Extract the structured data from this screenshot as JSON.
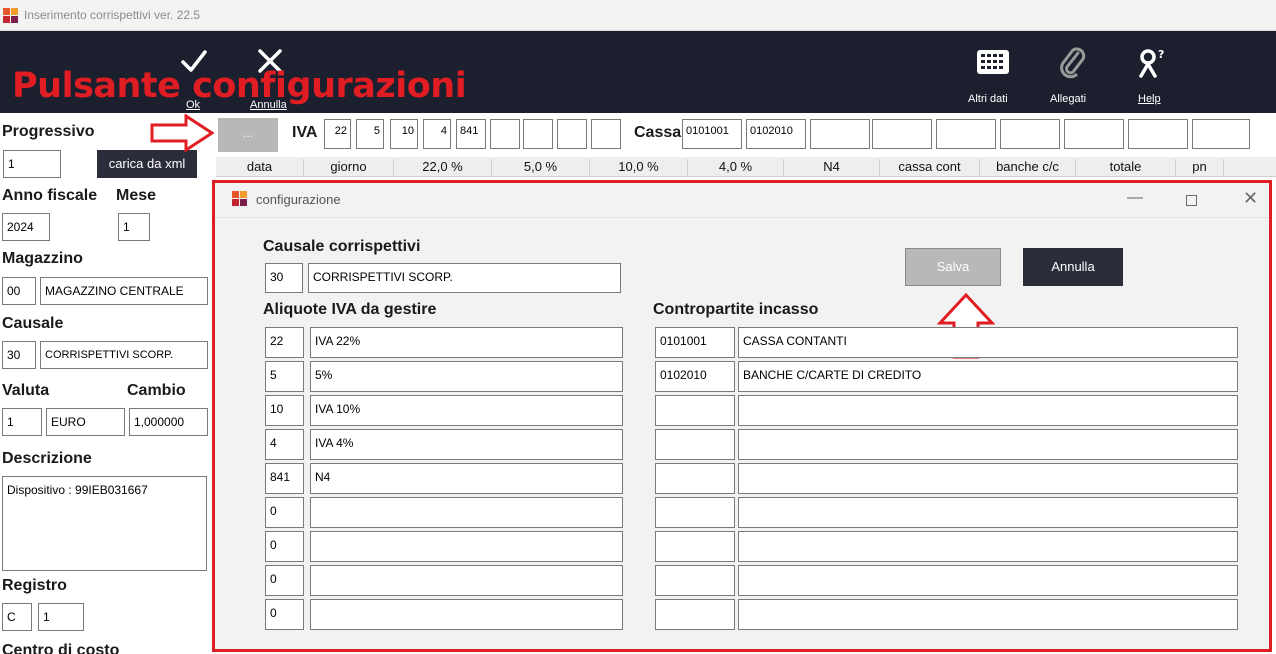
{
  "window": {
    "title": "Inserimento corrispettivi ver. 22.5"
  },
  "toolbar": {
    "ok_label": "Ok",
    "annulla_label": "Annulla",
    "altri_dati_label": "Altri dati",
    "allegati_label": "Allegati",
    "help_label": "Help"
  },
  "annotation": {
    "overlay_text": "Pulsante configurazioni"
  },
  "left_panel": {
    "progressivo_label": "Progressivo",
    "progressivo_value": "1",
    "carica_xml_label": "carica da xml",
    "anno_label": "Anno fiscale",
    "anno_value": "2024",
    "mese_label": "Mese",
    "mese_value": "1",
    "magazzino_label": "Magazzino",
    "magazzino_code": "00",
    "magazzino_name": "MAGAZZINO CENTRALE",
    "causale_label": "Causale",
    "causale_code": "30",
    "causale_name": "CORRISPETTIVI SCORP.",
    "valuta_label": "Valuta",
    "valuta_code": "1",
    "valuta_name": "EURO",
    "cambio_label": "Cambio",
    "cambio_value": "1,000000",
    "descrizione_label": "Descrizione",
    "descrizione_value": "Dispositivo : 99IEB031667",
    "registro_label": "Registro",
    "registro_code": "C",
    "registro_num": "1",
    "centro_costo_label": "Centro di costo"
  },
  "top_bar": {
    "config_button_label": "...",
    "iva_label": "IVA",
    "iva_values": [
      "22",
      "5",
      "10",
      "4",
      "841",
      "",
      "",
      "",
      ""
    ],
    "cassa_label": "Cassa",
    "cassa_values": [
      "0101001",
      "0102010",
      "",
      "",
      "",
      "",
      "",
      "",
      ""
    ]
  },
  "table_header": {
    "columns": [
      "data",
      "giorno",
      "22,0 %",
      "5,0 %",
      "10,0 %",
      "4,0 %",
      "N4",
      "cassa cont",
      "banche c/c",
      "totale",
      "pn"
    ]
  },
  "dialog": {
    "title": "configurazione",
    "causale_label": "Causale corrispettivi",
    "causale_code": "30",
    "causale_name": "CORRISPETTIVI SCORP.",
    "salva_label": "Salva",
    "annulla_label": "Annulla",
    "aliquote_label": "Aliquote IVA da gestire",
    "aliquote": [
      {
        "code": "22",
        "desc": "IVA 22%"
      },
      {
        "code": "5",
        "desc": "5%"
      },
      {
        "code": "10",
        "desc": "IVA 10%"
      },
      {
        "code": "4",
        "desc": "IVA 4%"
      },
      {
        "code": "841",
        "desc": "N4"
      },
      {
        "code": "0",
        "desc": ""
      },
      {
        "code": "0",
        "desc": ""
      },
      {
        "code": "0",
        "desc": ""
      },
      {
        "code": "0",
        "desc": ""
      }
    ],
    "contropartite_label": "Contropartite incasso",
    "contropartite": [
      {
        "code": "0101001",
        "desc": "CASSA CONTANTI"
      },
      {
        "code": "0102010",
        "desc": "BANCHE C/CARTE DI CREDITO"
      },
      {
        "code": "",
        "desc": ""
      },
      {
        "code": "",
        "desc": ""
      },
      {
        "code": "",
        "desc": ""
      },
      {
        "code": "",
        "desc": ""
      },
      {
        "code": "",
        "desc": ""
      },
      {
        "code": "",
        "desc": ""
      },
      {
        "code": "",
        "desc": ""
      }
    ]
  },
  "colors": {
    "toolbar_bg": "#1c1f2d",
    "annotation_red": "#e01d22",
    "salva_bg": "#b8b8b8",
    "annulla_bg": "#2b2d3a"
  }
}
